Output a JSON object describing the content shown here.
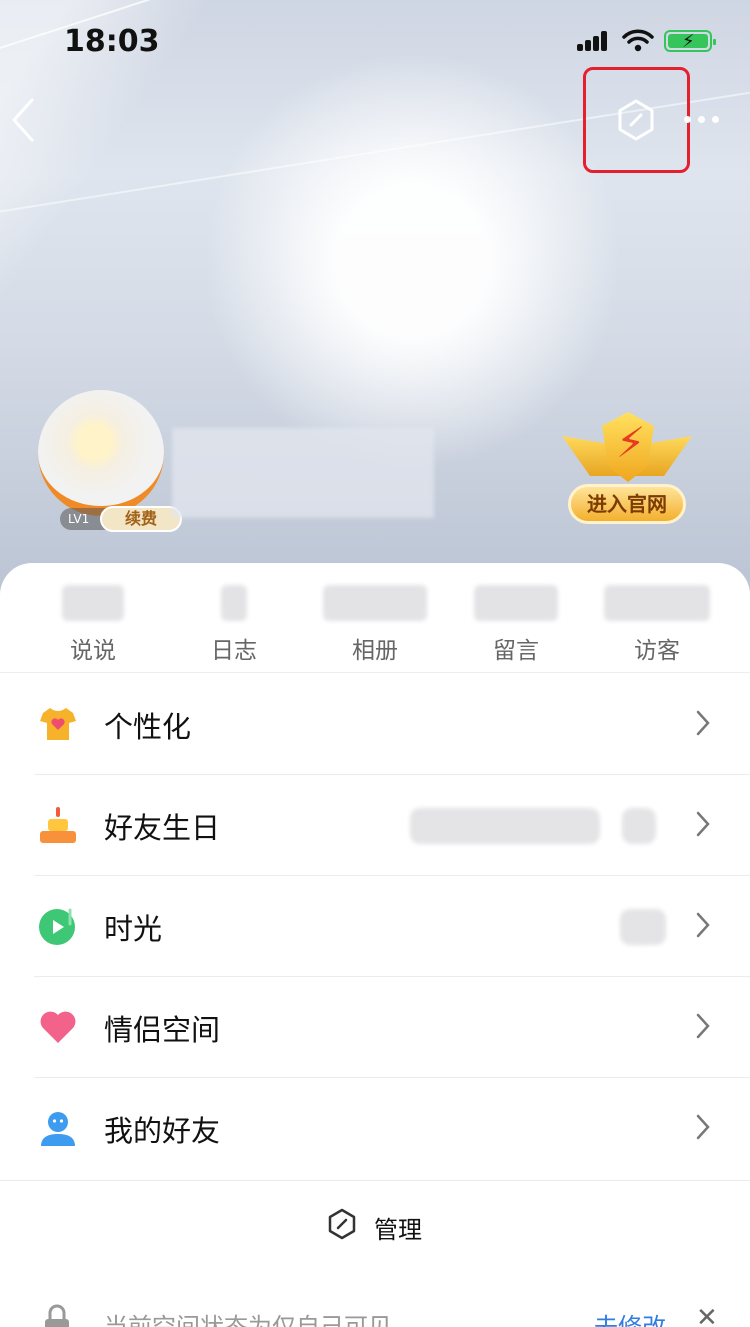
{
  "status_bar": {
    "time": "18:03"
  },
  "profile": {
    "level": "LV1",
    "renew_label": "续费"
  },
  "official_badge": {
    "label": "进入官网"
  },
  "stats": [
    {
      "label": "说说"
    },
    {
      "label": "日志"
    },
    {
      "label": "相册"
    },
    {
      "label": "留言"
    },
    {
      "label": "访客"
    }
  ],
  "menu": [
    {
      "title": "个性化",
      "icon": "tshirt-heart-icon"
    },
    {
      "title": "好友生日",
      "icon": "cake-icon"
    },
    {
      "title": "时光",
      "icon": "time-play-icon"
    },
    {
      "title": "情侣空间",
      "icon": "heart-icon"
    },
    {
      "title": "我的好友",
      "icon": "friends-icon"
    }
  ],
  "manage": {
    "label": "管理"
  },
  "privacy": {
    "text": "当前空间状态为仅自己可见",
    "action": "去修改"
  },
  "colors": {
    "accent": "#2f7de1",
    "highlight": "#e5202e",
    "battery": "#35c55b"
  }
}
